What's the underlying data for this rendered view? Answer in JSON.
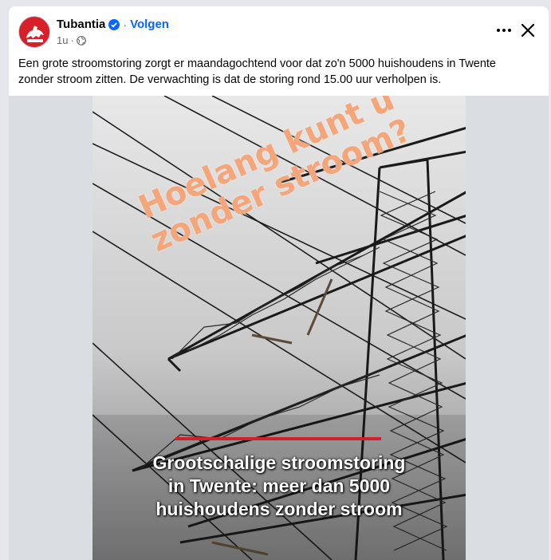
{
  "post": {
    "page_name": "Tubantia",
    "separator": "·",
    "follow_label": "Volgen",
    "time": "1u",
    "time_sep": "·",
    "text": "Een grote stroomstoring zorgt er maandagochtend voor dat zo'n 5000 huishoudens in Twente\nzonder stroom zitten. De verwachting is dat de storing rond 15.00 uur verholpen is."
  },
  "icons": {
    "avatar": "tubantia-logo",
    "verified": "verified-badge-icon",
    "audience": "globe-icon",
    "more": "more-icon",
    "close": "close-icon"
  },
  "media": {
    "overlay_text": "Hoelang kunt u zonder stroom?",
    "caption": "Grootschalige stroomstoring\nin Twente: meer dan 5000\nhuishoudens zonder stroom",
    "accent_color": "#d2202b",
    "overlay_color": "#f4a57a"
  },
  "colors": {
    "link": "#0866ff",
    "text": "#050505",
    "muted": "#65676b",
    "brand": "#d8202a"
  }
}
